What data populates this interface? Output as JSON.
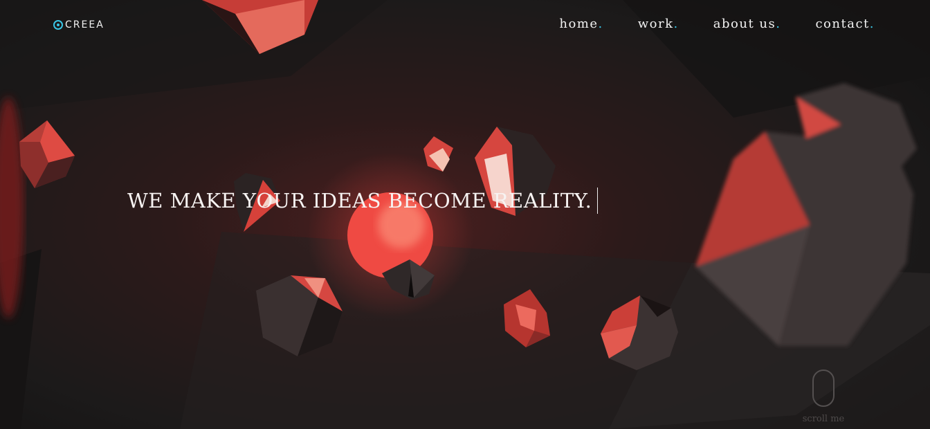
{
  "brand": {
    "name": "CREEA",
    "accent": "#39c6e6"
  },
  "nav": {
    "items": [
      {
        "label": "home",
        "dot": "."
      },
      {
        "label": "work",
        "dot": "."
      },
      {
        "label": "about us",
        "dot": "."
      },
      {
        "label": "contact",
        "dot": "."
      }
    ]
  },
  "hero": {
    "headline": "WE MAKE YOUR IDEAS BECOME REALITY."
  },
  "scroll": {
    "label": "scroll me"
  },
  "colors": {
    "background": "#1d1b1b",
    "glow": "#e8413c",
    "gem_red": "#d8403a",
    "gem_dark": "#2a2222"
  }
}
